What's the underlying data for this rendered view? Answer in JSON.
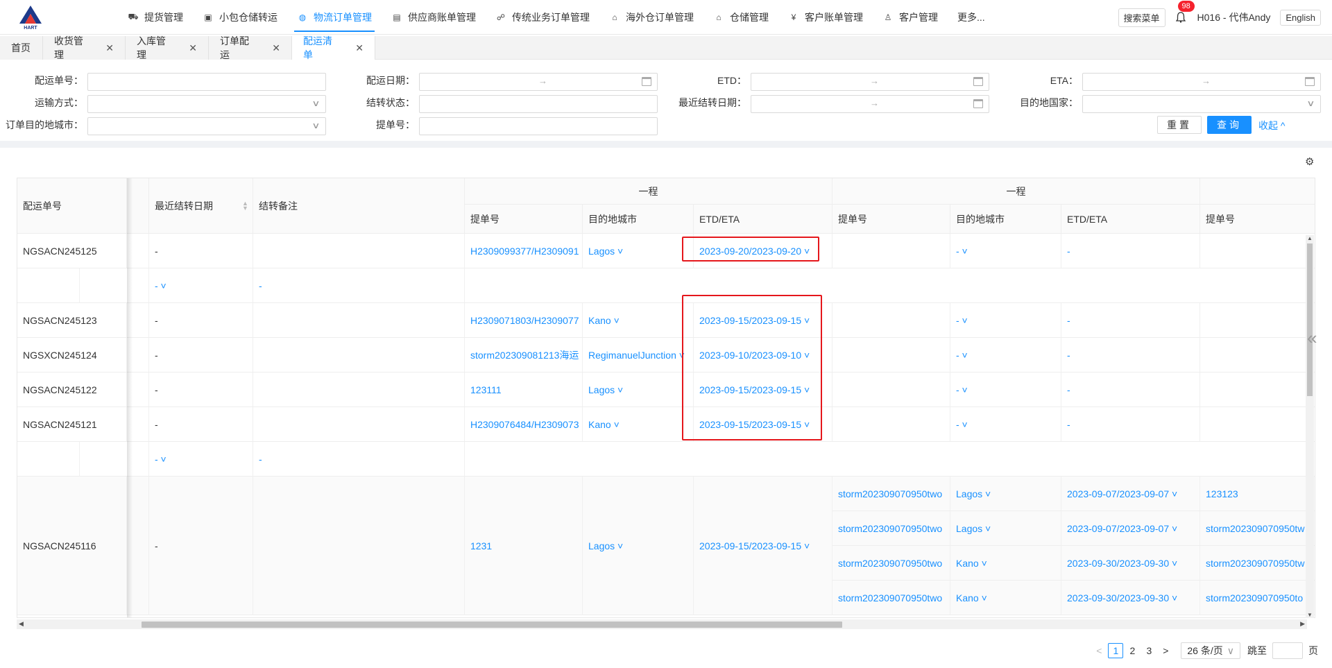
{
  "header": {
    "logo_text": "HART",
    "menu": [
      {
        "label": "提货管理",
        "icon": "truck-icon",
        "glyph": "⛟",
        "active": false
      },
      {
        "label": "小包仓储转运",
        "icon": "box-icon",
        "glyph": "▣",
        "active": false
      },
      {
        "label": "物流订单管理",
        "icon": "globe-icon",
        "glyph": "◍",
        "active": true
      },
      {
        "label": "供应商账单管理",
        "icon": "bill-icon",
        "glyph": "▤",
        "active": false
      },
      {
        "label": "传统业务订单管理",
        "icon": "sitemap-icon",
        "glyph": "☍",
        "active": false
      },
      {
        "label": "海外仓订单管理",
        "icon": "house-icon",
        "glyph": "⌂",
        "active": false
      },
      {
        "label": "仓储管理",
        "icon": "home-filled-icon",
        "glyph": "⌂",
        "active": false
      },
      {
        "label": "客户账单管理",
        "icon": "yen-icon",
        "glyph": "¥",
        "active": false
      },
      {
        "label": "客户管理",
        "icon": "user-icon",
        "glyph": "♙",
        "active": false
      },
      {
        "label": "更多...",
        "icon": "",
        "glyph": "",
        "active": false
      }
    ],
    "search_menu": "搜索菜单",
    "notification_count": "98",
    "user": "H016 - 代伟Andy",
    "language": "English"
  },
  "tabs": [
    {
      "label": "首页",
      "closable": false,
      "active": false
    },
    {
      "label": "收货管理",
      "closable": true,
      "active": false
    },
    {
      "label": "入库管理",
      "closable": true,
      "active": false
    },
    {
      "label": "订单配运",
      "closable": true,
      "active": false
    },
    {
      "label": "配运清单",
      "closable": true,
      "active": true
    }
  ],
  "filters": {
    "delivery_no": "配运单号：",
    "delivery_date": "配运日期：",
    "etd": "ETD：",
    "eta": "ETA：",
    "transport_mode": "运输方式：",
    "settle_status": "结转状态：",
    "last_settle_date": "最近结转日期：",
    "dest_country": "目的地国家：",
    "order_dest_city": "订单目的地城市：",
    "bill_no": "提单号：",
    "range_arrow": "→",
    "reset": "重置",
    "query": "查询",
    "collapse": "收起 ^"
  },
  "table": {
    "headers": {
      "delivery_no": "配运单号",
      "last_settle_date": "最近结转日期",
      "settle_note": "结转备注",
      "leg1_group": "一程",
      "leg2_group": "一程",
      "bill_no": "提单号",
      "dest_city": "目的地城市",
      "etd_eta": "ETD/ETA"
    },
    "rows": [
      {
        "no": "NGSACN245125",
        "settle": "-",
        "note": "",
        "bill": "H2309099377/H2309091",
        "city": "Lagos ˅",
        "etdeta": "2023-09-20/2023-09-20 ˅",
        "city2": "- ˅",
        "etdeta2": "-"
      },
      {
        "no": "",
        "settle": "- ˅",
        "note": "-",
        "sub": true
      },
      {
        "no": "NGSACN245123",
        "settle": "-",
        "note": "",
        "bill": "H2309071803/H2309077",
        "city": "Kano ˅",
        "etdeta": "2023-09-15/2023-09-15 ˅",
        "city2": "- ˅",
        "etdeta2": "-"
      },
      {
        "no": "NGSXCN245124",
        "settle": "-",
        "note": "",
        "bill": "storm202309081213海运",
        "city": "RegimanuelJunction ˅",
        "etdeta": "2023-09-10/2023-09-10 ˅",
        "city2": "- ˅",
        "etdeta2": "-"
      },
      {
        "no": "NGSACN245122",
        "settle": "-",
        "note": "",
        "bill": "123111",
        "city": "Lagos ˅",
        "etdeta": "2023-09-15/2023-09-15 ˅",
        "city2": "- ˅",
        "etdeta2": "-"
      },
      {
        "no": "NGSACN245121",
        "settle": "-",
        "note": "",
        "bill": "H2309076484/H2309073",
        "city": "Kano ˅",
        "etdeta": "2023-09-15/2023-09-15 ˅",
        "city2": "- ˅",
        "etdeta2": "-"
      },
      {
        "no": "",
        "settle": "- ˅",
        "note": "-",
        "sub": true
      }
    ],
    "big_row": {
      "no": "NGSACN245116",
      "settle": "-",
      "bill": "1231",
      "city": "Lagos ˅",
      "etdeta": "2023-09-15/2023-09-15 ˅",
      "sub": [
        {
          "bill2": "storm202309070950two",
          "city2": "Lagos ˅",
          "etdeta2": "2023-09-07/2023-09-07 ˅",
          "bill3": "123123"
        },
        {
          "bill2": "storm202309070950two",
          "city2": "Lagos ˅",
          "etdeta2": "2023-09-07/2023-09-07 ˅",
          "bill3": "storm202309070950tw"
        },
        {
          "bill2": "storm202309070950two",
          "city2": "Kano ˅",
          "etdeta2": "2023-09-30/2023-09-30 ˅",
          "bill3": "storm202309070950tw"
        },
        {
          "bill2": "storm202309070950two",
          "city2": "Kano ˅",
          "etdeta2": "2023-09-30/2023-09-30 ˅",
          "bill3": "storm202309070950to"
        }
      ]
    }
  },
  "pagination": {
    "prev": "<",
    "pages": [
      "1",
      "2",
      "3"
    ],
    "current": "1",
    "next": ">",
    "page_size": "26 条/页",
    "jump_to": "跳至",
    "page_unit": "页"
  },
  "colors": {
    "accent": "#1890ff",
    "highlight_box": "#e5161b"
  }
}
